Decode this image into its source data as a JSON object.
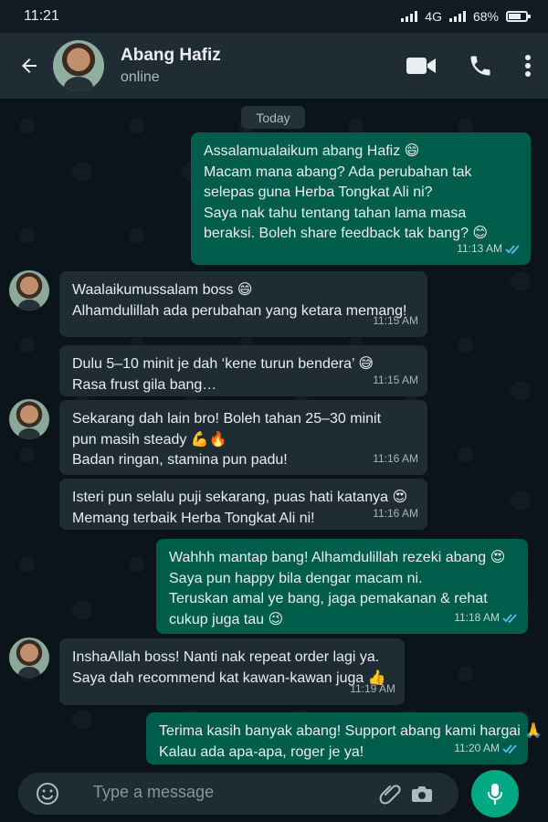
{
  "status": {
    "time": "11:21",
    "network": "4G",
    "battery": "68%"
  },
  "header": {
    "name": "Abang Hafiz",
    "status": "online"
  },
  "chat": {
    "date": "Today",
    "messages": [
      {
        "direction": "out",
        "lines": [
          "Assalamualaikum abang Hafiz 😄",
          "Macam mana abang? Ada perubahan tak",
          "selepas guna Herba Tongkat Ali ni?",
          "Saya nak tahu tentang tahan lama masa",
          "beraksi. Boleh share feedback tak bang? 😊"
        ],
        "time": "11:13 AM"
      },
      {
        "direction": "in",
        "lines": [
          "Waalaikumussalam boss 😄",
          "Alhamdulillah ada perubahan yang ketara memang!"
        ],
        "time": "11:15 AM"
      },
      {
        "direction": "in",
        "lines": [
          "Dulu 5–10 minit je dah ‘kene turun bendera’ 😅",
          "Rasa frust gila bang…"
        ],
        "time": "11:15 AM"
      },
      {
        "direction": "in",
        "lines": [
          "Sekarang dah lain bro! Boleh tahan 25–30 minit",
          "pun masih steady 💪🔥",
          "Badan ringan, stamina pun padu!"
        ],
        "time": "11:16 AM"
      },
      {
        "direction": "in",
        "lines": [
          "Isteri pun selalu puji sekarang, puas hati katanya 😍",
          "Memang terbaik Herba Tongkat Ali ni!"
        ],
        "time": "11:16 AM"
      },
      {
        "direction": "out",
        "lines": [
          "Wahhh mantap bang! Alhamdulillah rezeki abang 😍",
          "Saya pun happy bila dengar macam ni.",
          "Teruskan amal ye bang, jaga pemakanan & rehat",
          "cukup juga tau 😉"
        ],
        "time": "11:18 AM"
      },
      {
        "direction": "in",
        "lines": [
          "InshaAllah boss! Nanti nak repeat order lagi ya.",
          "Saya dah recommend kat kawan-kawan juga 👍"
        ],
        "time": "11:19 AM"
      },
      {
        "direction": "out",
        "lines": [
          "Terima kasih banyak abang! Support abang kami hargai 🙏",
          "Kalau ada apa-apa, roger je ya!"
        ],
        "time": "11:20 AM"
      }
    ]
  },
  "input": {
    "placeholder": "Type a message"
  },
  "colors": {
    "accent": "#00a884",
    "outgoing_bubble": "#005c4b",
    "incoming_bubble": "#202c33",
    "read_ticks": "#53bdeb"
  },
  "icons": {
    "back": "arrow-left-icon",
    "video": "video-camera-icon",
    "call": "phone-icon",
    "menu": "more-vertical-icon",
    "emoji": "emoji-icon",
    "attach": "paperclip-icon",
    "camera": "camera-icon",
    "mic": "microphone-icon"
  }
}
